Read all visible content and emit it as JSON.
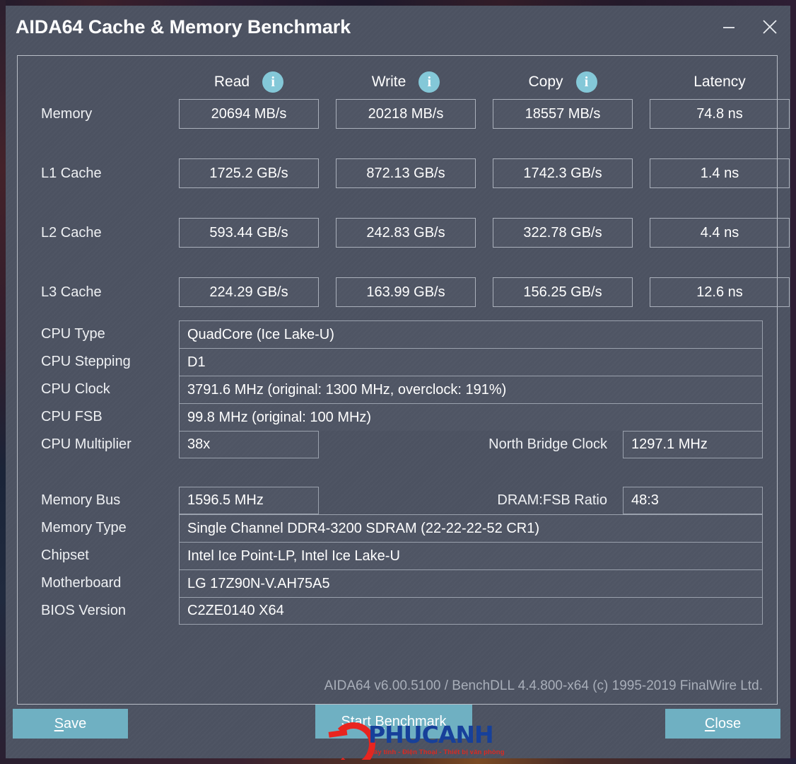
{
  "window": {
    "title": "AIDA64 Cache & Memory Benchmark",
    "minimize_label": "Minimize",
    "close_label": "Close"
  },
  "benchmark": {
    "headers": [
      {
        "label": "Read",
        "has_info": true
      },
      {
        "label": "Write",
        "has_info": true
      },
      {
        "label": "Copy",
        "has_info": true
      },
      {
        "label": "Latency",
        "has_info": false
      }
    ],
    "rows": [
      {
        "label": "Memory",
        "read": "20694 MB/s",
        "write": "20218 MB/s",
        "copy": "18557 MB/s",
        "latency": "74.8 ns"
      },
      {
        "label": "L1 Cache",
        "read": "1725.2 GB/s",
        "write": "872.13 GB/s",
        "copy": "1742.3 GB/s",
        "latency": "1.4 ns"
      },
      {
        "label": "L2 Cache",
        "read": "593.44 GB/s",
        "write": "242.83 GB/s",
        "copy": "322.78 GB/s",
        "latency": "4.4 ns"
      },
      {
        "label": "L3 Cache",
        "read": "224.29 GB/s",
        "write": "163.99 GB/s",
        "copy": "156.25 GB/s",
        "latency": "12.6 ns"
      }
    ]
  },
  "cpu_info": {
    "type_label": "CPU Type",
    "type_value": "QuadCore   (Ice Lake-U)",
    "stepping_label": "CPU Stepping",
    "stepping_value": "D1",
    "clock_label": "CPU Clock",
    "clock_value": "3791.6 MHz  (original: 1300 MHz, overclock: 191%)",
    "fsb_label": "CPU FSB",
    "fsb_value": "99.8 MHz  (original: 100 MHz)",
    "multiplier_label": "CPU Multiplier",
    "multiplier_value": "38x",
    "north_bridge_label": "North Bridge Clock",
    "north_bridge_value": "1297.1 MHz"
  },
  "memory_info": {
    "bus_label": "Memory Bus",
    "bus_value": "1596.5 MHz",
    "dram_ratio_label": "DRAM:FSB Ratio",
    "dram_ratio_value": "48:3",
    "type_label": "Memory Type",
    "type_value": "Single Channel DDR4-3200 SDRAM  (22-22-22-52 CR1)",
    "chipset_label": "Chipset",
    "chipset_value": "Intel Ice Point-LP, Intel Ice Lake-U",
    "motherboard_label": "Motherboard",
    "motherboard_value": "LG 17Z90N-V.AH75A5",
    "bios_label": "BIOS Version",
    "bios_value": "C2ZE0140 X64"
  },
  "footer": {
    "version_text": "AIDA64 v6.00.5100 / BenchDLL 4.4.800-x64  (c) 1995-2019 FinalWire Ltd."
  },
  "buttons": {
    "save": {
      "accel": "S",
      "rest": "ave"
    },
    "start": {
      "pre": "Start ",
      "accel": "B",
      "rest": "enchmark"
    },
    "close": {
      "accel": "C",
      "rest": "lose"
    }
  },
  "watermark": {
    "name": "PHUCANH",
    "registered": "®",
    "tagline": "Máy tính - Điện Thoại - Thiết bị văn phòng"
  },
  "colors": {
    "window_bg": "#4d5362",
    "button_teal": "#6fb0c2",
    "info_icon": "#84c8d8",
    "border": "#aab0bb",
    "text": "#ffffff",
    "muted_text": "#a8aeb9"
  }
}
